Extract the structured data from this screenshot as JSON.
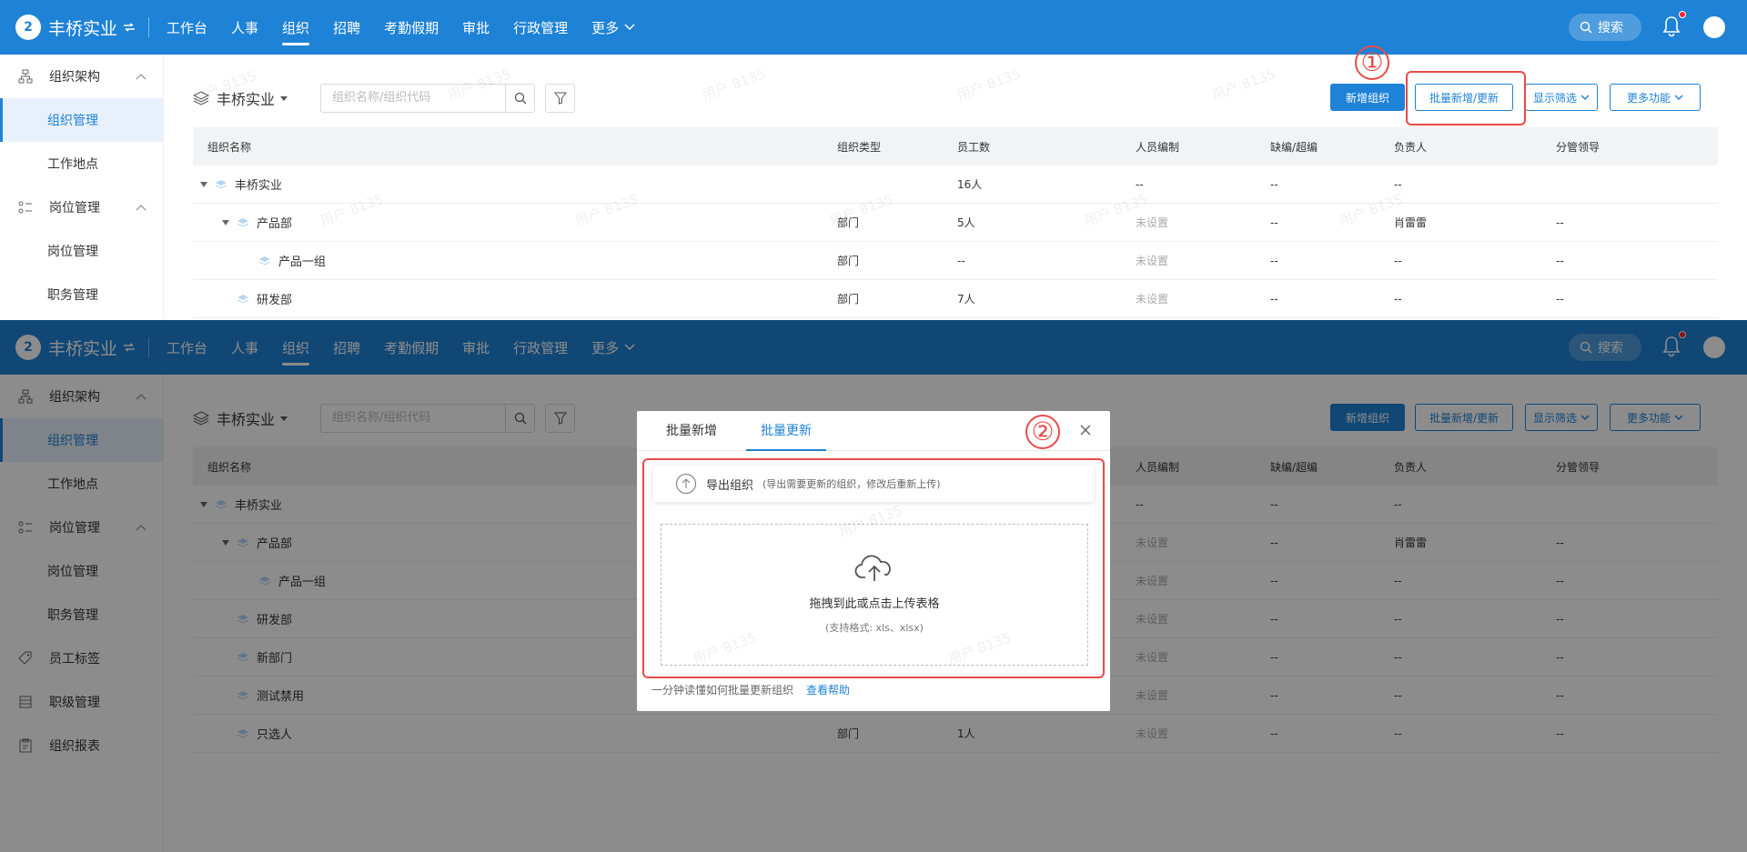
{
  "topbar": {
    "logo_text": "2",
    "company": "丰桥实业",
    "nav": [
      "工作台",
      "人事",
      "组织",
      "招聘",
      "考勤假期",
      "审批",
      "行政管理",
      "更多"
    ],
    "active_nav": "组织",
    "search_label": "搜索"
  },
  "sidebar": {
    "group_org": "组织架构",
    "org_items": [
      "组织管理",
      "工作地点"
    ],
    "group_post": "岗位管理",
    "post_items": [
      "岗位管理",
      "职务管理"
    ],
    "extra_items": [
      "员工标签",
      "职级管理",
      "组织报表"
    ]
  },
  "toolbar": {
    "org_selector": "丰桥实业",
    "search_placeholder": "组织名称/组织代码",
    "add_org": "新增组织",
    "batch": "批量新增/更新",
    "display_filter": "显示筛选",
    "more_functions": "更多功能"
  },
  "table": {
    "columns": [
      "组织名称",
      "组织类型",
      "员工数",
      "人员编制",
      "缺编/超编",
      "负责人",
      "分管领导"
    ],
    "rows": [
      {
        "name": "丰桥实业",
        "type": "",
        "count": "16人",
        "quota": "--",
        "gap": "--",
        "leader": "--",
        "manager": ""
      },
      {
        "name": "产品部",
        "type": "部门",
        "count": "5人",
        "quota": "未设置",
        "gap": "--",
        "leader": "肖雷雷",
        "manager": "--"
      },
      {
        "name": "产品一组",
        "type": "部门",
        "count": "--",
        "quota": "未设置",
        "gap": "--",
        "leader": "--",
        "manager": "--"
      },
      {
        "name": "研发部",
        "type": "部门",
        "count": "7人",
        "quota": "未设置",
        "gap": "--",
        "leader": "--",
        "manager": "--"
      },
      {
        "name": "新部门",
        "type": "",
        "count": "",
        "quota": "未设置",
        "gap": "--",
        "leader": "--",
        "manager": "--"
      },
      {
        "name": "测试禁用",
        "type": "",
        "count": "",
        "quota": "未设置",
        "gap": "--",
        "leader": "--",
        "manager": "--"
      },
      {
        "name": "只选人",
        "type": "部门",
        "count": "1人",
        "quota": "未设置",
        "gap": "--",
        "leader": "--",
        "manager": "--"
      }
    ]
  },
  "watermark": "用户 8135",
  "modal": {
    "tab_add": "批量新增",
    "tab_update": "批量更新",
    "export_label": "导出组织",
    "export_hint": "(导出需要更新的组织，修改后重新上传)",
    "drop_main": "拖拽到此或点击上传表格",
    "drop_sub": "(支持格式: xls、xlsx)",
    "help_text": "一分钟读懂如何批量更新组织",
    "help_link": "查看帮助"
  },
  "annotations": {
    "step1": "①",
    "step2": "②",
    "color": "#e84a4a"
  },
  "colors": {
    "brand": "#1e82d6"
  }
}
